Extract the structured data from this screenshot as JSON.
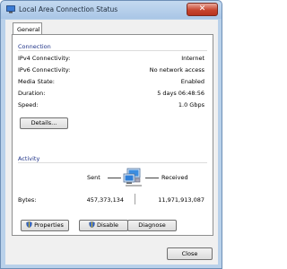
{
  "window": {
    "title": "Local Area Connection Status",
    "close_glyph": "✕"
  },
  "tab": {
    "label": "General"
  },
  "connection": {
    "heading": "Connection",
    "rows": [
      {
        "label": "IPv4 Connectivity:",
        "value": "Internet"
      },
      {
        "label": "IPv6 Connectivity:",
        "value": "No network access"
      },
      {
        "label": "Media State:",
        "value": "Enabled"
      },
      {
        "label": "Duration:",
        "value": "5 days 06:48:56"
      },
      {
        "label": "Speed:",
        "value": "1.0 Gbps"
      }
    ],
    "details_button": "Details..."
  },
  "activity": {
    "heading": "Activity",
    "sent_label": "Sent",
    "received_label": "Received",
    "bytes_label": "Bytes:",
    "bytes_sent": "457,373,134",
    "bytes_received": "11,971,913,087",
    "network_icon": "network-computers-icon"
  },
  "buttons": {
    "properties": "Properties",
    "disable": "Disable",
    "diagnose": "Diagnose",
    "close": "Close"
  }
}
